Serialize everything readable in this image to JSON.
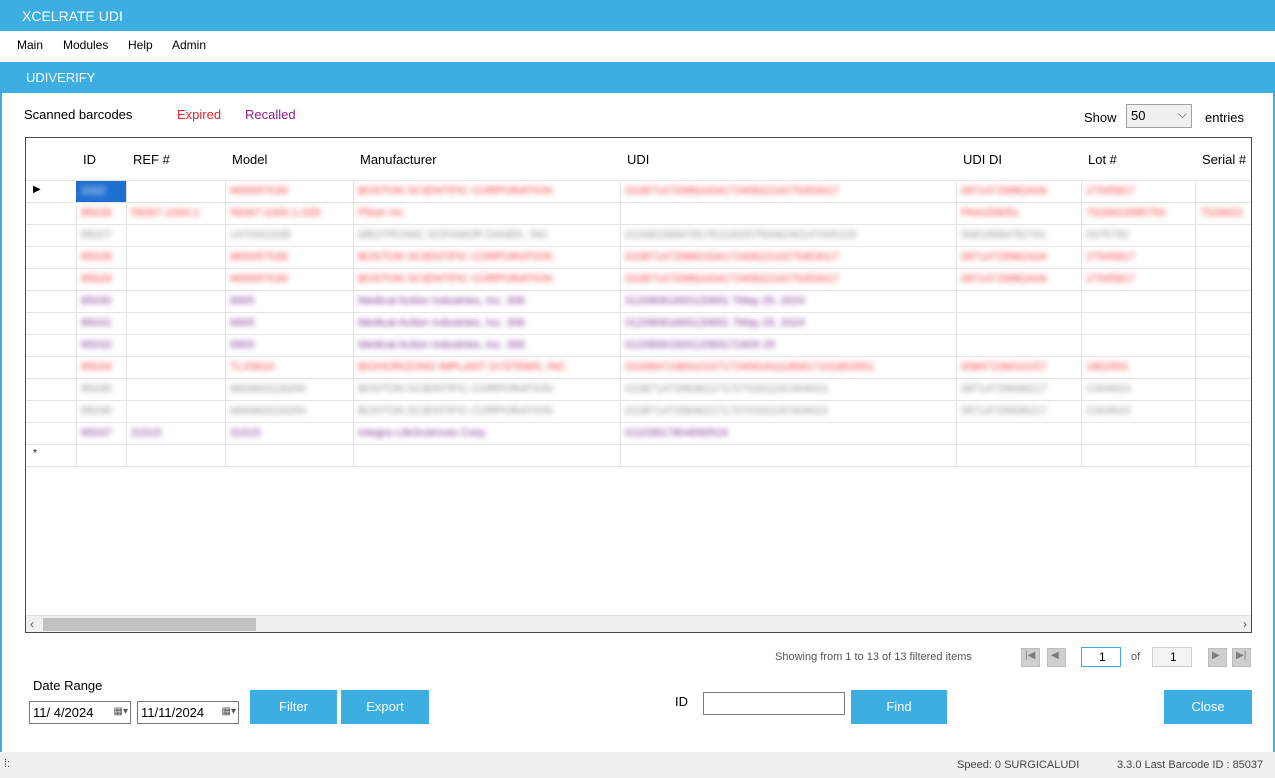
{
  "window": {
    "title": "XCELRATE UDI"
  },
  "menu": [
    "Main",
    "Modules",
    "Help",
    "Admin"
  ],
  "panel": {
    "title": "UDIVERIFY"
  },
  "legend": {
    "scanned": "Scanned barcodes",
    "expired": "Expired",
    "recalled": "Recalled"
  },
  "entries": {
    "show": "Show",
    "value": "50",
    "suffix": "entries"
  },
  "grid": {
    "columns": [
      "ID",
      "REF #",
      "Model",
      "Manufacturer",
      "UDI",
      "UDI DI",
      "Lot #",
      "Serial #"
    ],
    "rows": [
      {
        "color": "blue-sel",
        "marker": "▶",
        "cells": [
          "1022",
          "",
          "M00057030",
          "BOSTON SCIENTIFIC CORPORATION",
          "01087147299624341724062210275453017",
          "08714729962434",
          "27545817",
          ""
        ]
      },
      {
        "color": "red",
        "marker": "",
        "cells": [
          "85026",
          "59267-1000-1",
          "59267-1000-1-025",
          "Pfizer Inc",
          "",
          "PAA159051",
          "7526622995754",
          "7526622"
        ]
      },
      {
        "color": "grey",
        "marker": "",
        "cells": [
          "85027",
          "",
          "1470001035",
          "MEDTRONIC SOFAMOR DANEK, INC",
          "01008156847827611002575006240147005103",
          "00615684782761",
          "0075792",
          ""
        ]
      },
      {
        "color": "red",
        "marker": "",
        "cells": [
          "85028",
          "",
          "M00057030",
          "BOSTON SCIENTIFIC CORPORATION",
          "01087147299624341724062210275453017",
          "08714729962434",
          "27545817",
          ""
        ]
      },
      {
        "color": "red",
        "marker": "",
        "cells": [
          "85029",
          "",
          "M00057030",
          "BOSTON SCIENTIFIC CORPORATION",
          "01087147299624341724062210275453017",
          "08714729962434",
          "27545817",
          ""
        ]
      },
      {
        "color": "purple",
        "marker": "",
        "cells": [
          "85030",
          "",
          "6905",
          "Medical Action Industries, Inc. 306",
          "01208061600120691 7May 29, 2024",
          "",
          "",
          ""
        ]
      },
      {
        "color": "purple",
        "marker": "",
        "cells": [
          "85031",
          "",
          "6905",
          "Medical Action Industries, Inc. 306",
          "01208061600120691 7May 29, 2024",
          "",
          "",
          ""
        ]
      },
      {
        "color": "purple",
        "marker": "",
        "cells": [
          "85032",
          "",
          "6905",
          "Medical Action Industries, Inc. 306",
          "0120806160012069172405 29",
          "",
          "",
          ""
        ]
      },
      {
        "color": "red",
        "marker": "",
        "cells": [
          "85034",
          "",
          "TLX5610",
          "BIOHORIZONS IMPLANT SYSTEMS, INC",
          "01008472360101571724061611180617101802551",
          "00847236010157",
          "1802551",
          ""
        ]
      },
      {
        "color": "grey",
        "marker": "",
        "cells": [
          "85035",
          "",
          "M00663116200",
          "BOSTON SCIENTIFIC CORPORATION",
          "01087147299362171727033110C004910",
          "08714729936217",
          "C004910",
          ""
        ]
      },
      {
        "color": "grey",
        "marker": "",
        "cells": [
          "85036",
          "",
          "M00663116200",
          "BOSTON SCIENTIFIC CORPORATION",
          "01087147299362171727033110C004910",
          "08714729936217",
          "C004910",
          ""
        ]
      },
      {
        "color": "purple",
        "marker": "",
        "cells": [
          "85037",
          "31515",
          "31515",
          "Integra LifeSciences Corp.",
          "01103817804690524",
          "",
          "",
          ""
        ]
      },
      {
        "color": "none",
        "marker": "*",
        "cells": [
          "",
          "",
          "",
          "",
          "",
          "",
          "",
          ""
        ]
      }
    ]
  },
  "pager": {
    "info": "Showing from 1 to 13 of 13 filtered items",
    "page": "1",
    "of": "of",
    "total": "1"
  },
  "controls": {
    "date_range_label": "Date Range",
    "date_from": "11/ 4/2024",
    "date_to": "11/11/2024",
    "filter": "Filter",
    "export": "Export",
    "id_label": "ID",
    "find": "Find",
    "close": "Close"
  },
  "status": {
    "speed": "Speed: 0  SURGICALUDI",
    "version": "3.3.0  Last Barcode ID : 85037"
  },
  "colors": {
    "accent": "#3daee2",
    "expired": "#e8202a",
    "recalled": "#8b1e8f"
  }
}
